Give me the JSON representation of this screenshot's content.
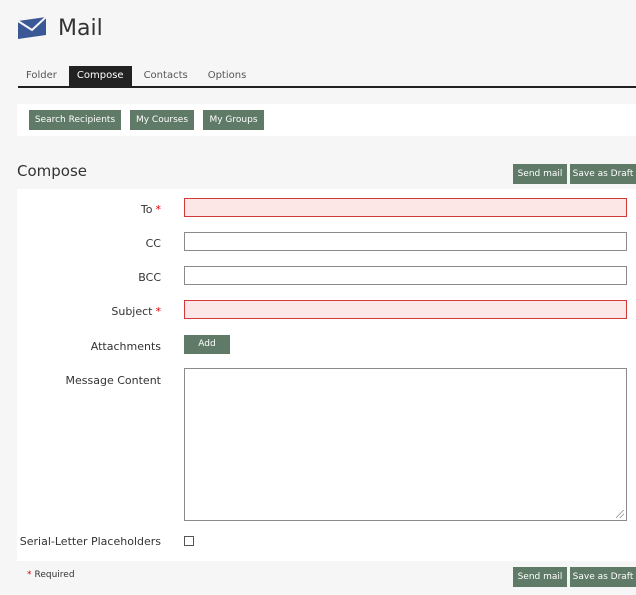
{
  "header": {
    "title": "Mail",
    "icon": "envelope-icon"
  },
  "tabs": [
    {
      "label": "Folder",
      "active": false
    },
    {
      "label": "Compose",
      "active": true
    },
    {
      "label": "Contacts",
      "active": false
    },
    {
      "label": "Options",
      "active": false
    }
  ],
  "toolbar": {
    "search_recipients": "Search Recipients",
    "my_courses": "My Courses",
    "my_groups": "My Groups"
  },
  "compose": {
    "title": "Compose",
    "send_mail": "Send mail",
    "save_draft": "Save as Draft"
  },
  "form": {
    "to": {
      "label": "To",
      "value": ""
    },
    "cc": {
      "label": "CC",
      "value": ""
    },
    "bcc": {
      "label": "BCC",
      "value": ""
    },
    "subject": {
      "label": "Subject",
      "value": ""
    },
    "attachments": {
      "label": "Attachments",
      "button": "Add"
    },
    "message": {
      "label": "Message Content",
      "value": ""
    },
    "serial_letter": {
      "label": "Serial-Letter Placeholders",
      "checked": false
    },
    "required_mark": "*"
  },
  "footer": {
    "required_text": "Required",
    "send_mail": "Send mail",
    "save_draft": "Save as Draft"
  },
  "colors": {
    "button_green": "#5f7a66",
    "required_red": "#d00000",
    "error_border": "#d23a3a",
    "error_fill": "#fde6e6",
    "envelope": "#3a5896"
  }
}
